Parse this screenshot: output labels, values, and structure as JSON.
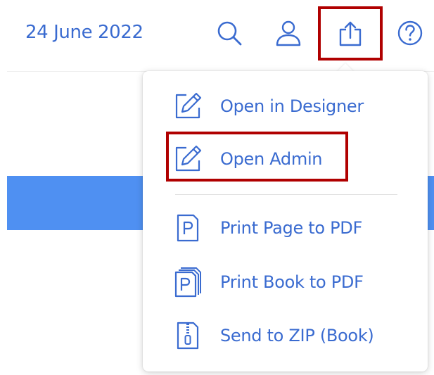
{
  "header": {
    "date": "24 June 2022",
    "icons": [
      "search-icon",
      "user-icon",
      "export-icon",
      "help-icon"
    ],
    "highlight_color": "#b00000",
    "accent_color": "#3a6bd0"
  },
  "banner": {
    "color": "#4f90f2"
  },
  "export_menu": {
    "items": [
      {
        "label": "Open in Designer",
        "icon": "edit-icon"
      },
      {
        "label": "Open Admin",
        "icon": "edit-icon"
      },
      {
        "label": "Print Page to PDF",
        "icon": "pdf-page-icon"
      },
      {
        "label": "Print Book to PDF",
        "icon": "pdf-book-icon"
      },
      {
        "label": "Send to ZIP (Book)",
        "icon": "zip-file-icon"
      }
    ]
  }
}
